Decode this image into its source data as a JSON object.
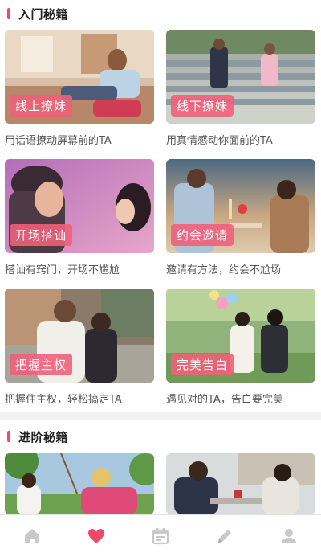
{
  "section_intro": {
    "title": "入门秘籍",
    "cards": [
      {
        "tag": "线上撩妹",
        "caption": "用话语撩动屏幕前的TA"
      },
      {
        "tag": "线下撩妹",
        "caption": "用真情感动你面前的TA"
      },
      {
        "tag": "开场搭讪",
        "caption": "搭讪有窍门，开场不尴尬"
      },
      {
        "tag": "约会邀请",
        "caption": "邀请有方法，约会不尬场"
      },
      {
        "tag": "把握主权",
        "caption": "把握住主权，轻松搞定TA"
      },
      {
        "tag": "完美告白",
        "caption": "遇见对的TA，告白要完美"
      }
    ]
  },
  "section_advanced": {
    "title": "进阶秘籍"
  },
  "tabbar": {
    "tabs": [
      {
        "icon": "home-icon",
        "active": false
      },
      {
        "icon": "heart-icon",
        "active": true
      },
      {
        "icon": "calendar-icon",
        "active": false
      },
      {
        "icon": "pencil-icon",
        "active": false
      },
      {
        "icon": "user-icon",
        "active": false
      }
    ]
  },
  "colors": {
    "accent": "#f2496a",
    "tab_inactive": "#c9c9c9"
  }
}
